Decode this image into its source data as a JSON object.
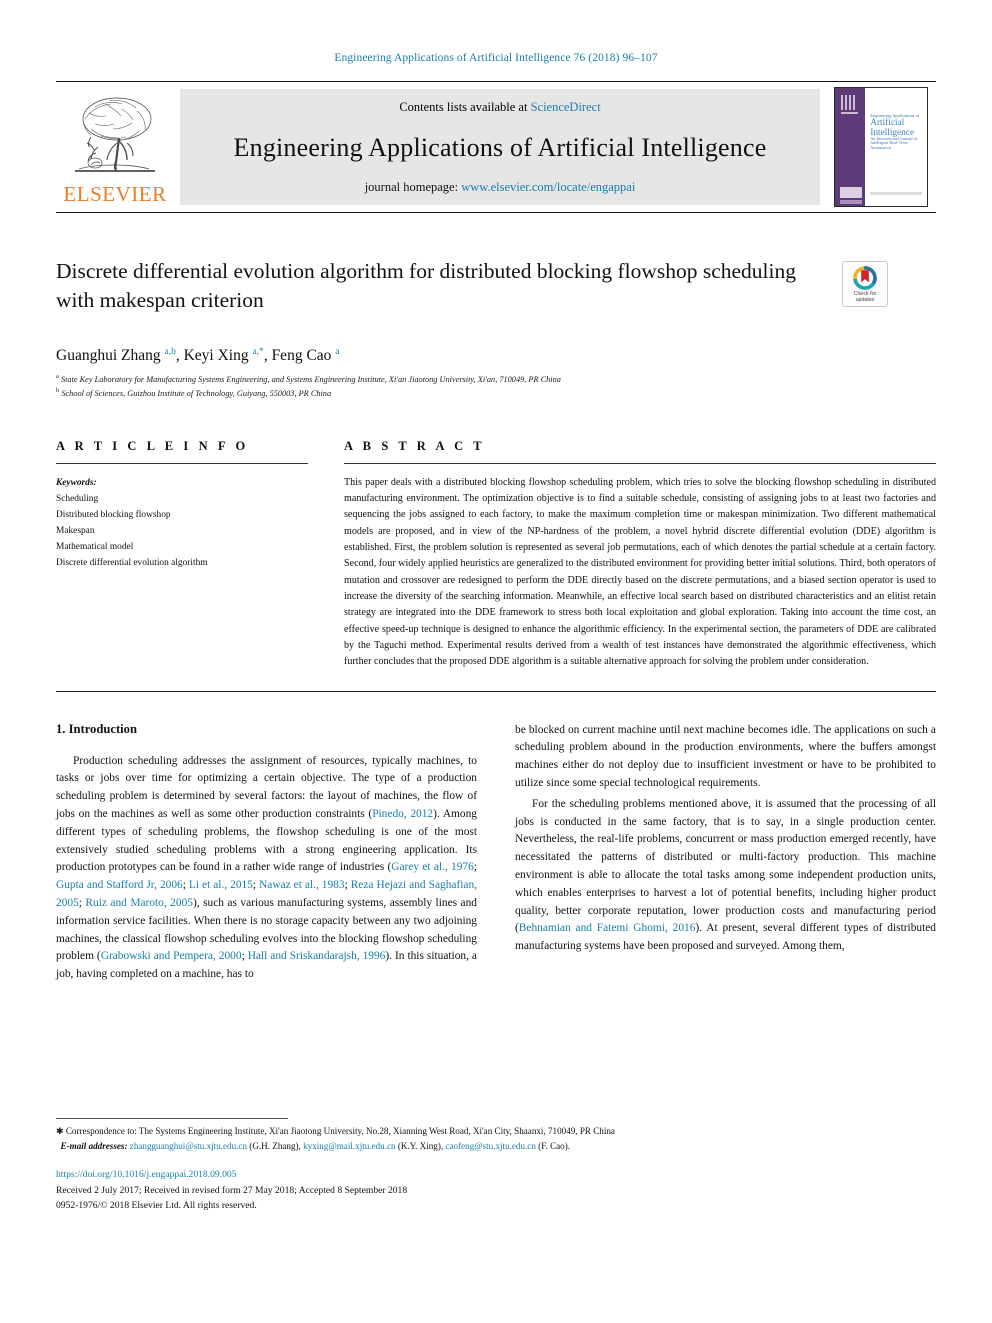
{
  "running_head": "Engineering Applications of Artificial Intelligence 76 (2018) 96–107",
  "masthead": {
    "contents_prefix": "Contents lists available at ",
    "sciencedirect": "ScienceDirect",
    "journal_title": "Engineering Applications of Artificial Intelligence",
    "homepage_prefix": "journal homepage: ",
    "homepage_url": "www.elsevier.com/locate/engappai",
    "publisher_wordmark": "ELSEVIER",
    "cover": {
      "line1": "Engineering Applications of",
      "line2": "Artificial",
      "line3": "Intelligence",
      "line4": "An International Journal of Intelligent Real-Time Automation"
    }
  },
  "article": {
    "title": "Discrete differential evolution algorithm for distributed blocking flowshop scheduling with makespan criterion",
    "crossmark_line1": "Check for",
    "crossmark_line2": "updates",
    "authors_html": "Guanghui Zhang <sup>a,b</sup>, Keyi Xing <sup>a,*</sup>, Feng Cao <sup>a</sup>",
    "affiliation_a": "State Key Laboratory for Manufacturing Systems Engineering, and Systems Engineering Institute, Xi'an Jiaotong University, Xi'an, 710049, PR China",
    "affiliation_b": "School of Sciences, Guizhou Institute of Technology, Guiyang, 550003, PR China"
  },
  "sections": {
    "article_info_heading": "A R T I C L E   I N F O",
    "abstract_heading": "A B S T R A C T"
  },
  "keywords": {
    "heading": "Keywords:",
    "items": [
      "Scheduling",
      "Distributed blocking flowshop",
      "Makespan",
      "Mathematical model",
      "Discrete differential evolution algorithm"
    ]
  },
  "abstract": "This paper deals with a distributed blocking flowshop scheduling problem, which tries to solve the blocking flowshop scheduling in distributed manufacturing environment. The optimization objective is to find a suitable schedule, consisting of assigning jobs to at least two factories and sequencing the jobs assigned to each factory, to make the maximum completion time or makespan minimization. Two different mathematical models are proposed, and in view of the NP-hardness of the problem, a novel hybrid discrete differential evolution (DDE) algorithm is established. First, the problem solution is represented as several job permutations, each of which denotes the partial schedule at a certain factory. Second, four widely applied heuristics are generalized to the distributed environment for providing better initial solutions. Third, both operators of mutation and crossover are redesigned to perform the DDE directly based on the discrete permutations, and a biased section operator is used to increase the diversity of the searching information. Meanwhile, an effective local search based on distributed characteristics and an elitist retain strategy are integrated into the DDE framework to stress both local exploitation and global exploration. Taking into account the time cost, an effective speed-up technique is designed to enhance the algorithmic efficiency. In the experimental section, the parameters of DDE are calibrated by the Taguchi method. Experimental results derived from a wealth of test instances have demonstrated the algorithmic effectiveness, which further concludes that the proposed DDE algorithm is a suitable alternative approach for solving the problem under consideration.",
  "introduction": {
    "heading": "1.  Introduction",
    "left_paragraph_html": "Production scheduling addresses the assignment of resources, typically machines, to tasks or jobs over time for optimizing a certain objective. The type of a production scheduling problem is determined by several factors: the layout of machines, the flow of jobs on the machines as well as some other production constraints (<span class=\"ref\">Pinedo, 2012</span>). Among different types of scheduling problems, the flowshop scheduling is one of the most extensively studied scheduling problems with a strong engineering application. Its production prototypes can be found in a rather wide range of industries (<span class=\"ref\">Garey et al., 1976</span>; <span class=\"ref\">Gupta and Stafford Jr, 2006</span>; <span class=\"ref\">Li et al., 2015</span>; <span class=\"ref\">Nawaz et al., 1983</span>; <span class=\"ref\">Reza Hejazi and Saghafian, 2005</span>; <span class=\"ref\">Ruiz and Maroto, 2005</span>), such as various manufacturing systems, assembly lines and information service facilities. When there is no storage capacity between any two adjoining machines, the classical flowshop scheduling evolves into the blocking flowshop scheduling problem (<span class=\"ref\">Grabowski and Pempera, 2000</span>; <span class=\"ref\">Hall and Sriskandarajsh, 1996</span>). In this situation, a job, having completed on a machine, has to",
    "right_paragraph1_html": "be blocked on current machine until next machine becomes idle. The applications on such a scheduling problem abound in the production environments, where the buffers amongst machines either do not deploy due to insufficient investment or have to be prohibited to utilize since some special technological requirements.",
    "right_paragraph2_html": "For the scheduling problems mentioned above, it is assumed that the processing of all jobs is conducted in the same factory, that is to say, in a single production center. Nevertheless, the real-life problems, concurrent or mass production emerged recently, have necessitated the patterns of distributed or multi-factory production. This machine environment is able to allocate the total tasks among some independent production units, which enables enterprises to harvest a lot of potential benefits, including higher product quality, better corporate reputation, lower production costs and manufacturing period (<span class=\"ref\">Behnamian and Fatemi Ghomi, 2016</span>). At present, several different types of distributed manufacturing systems have been proposed and surveyed. Among them,"
  },
  "footnotes": {
    "correspondence_label": "Correspondence to:",
    "correspondence_text": " The Systems Engineering Institute, Xi'an Jiaotong University, No.28, Xianning West Road, Xi'an City, Shaanxi, 710049, PR China",
    "email_label": "E-mail addresses:",
    "emails": [
      {
        "address": "zhangguanghui@stu.xjtu.edu.cn",
        "person": "(G.H. Zhang)"
      },
      {
        "address": "kyxing@mail.xjtu.edu.cn",
        "person": "(K.Y. Xing)"
      },
      {
        "address": "caofeng@stu.xjtu.edu.cn",
        "person": "(F. Cao)."
      }
    ]
  },
  "publication": {
    "doi": "https://doi.org/10.1016/j.engappai.2018.09.005",
    "history": "Received 2 July 2017; Received in revised form 27 May 2018; Accepted 8 September 2018",
    "copyright": "0952-1976/© 2018 Elsevier Ltd. All rights reserved."
  },
  "colors": {
    "link": "#1a7fa8",
    "elsevier_orange": "#ec7c26",
    "cover_purple": "#5d3a78"
  }
}
